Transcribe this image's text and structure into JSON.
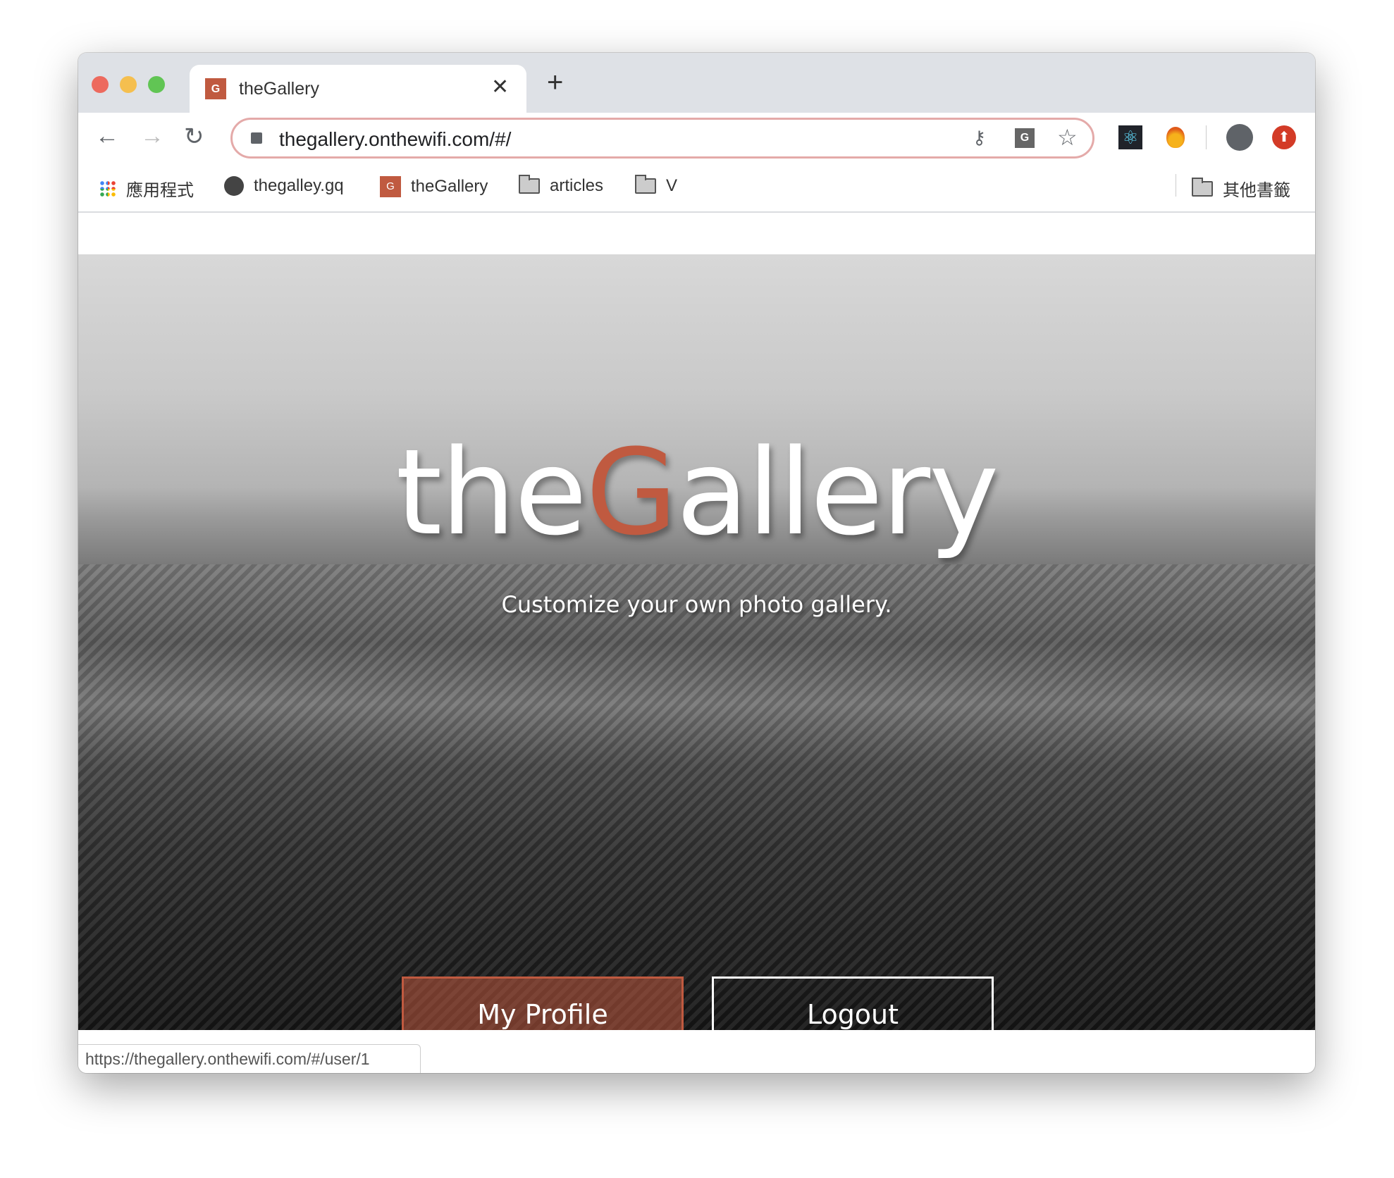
{
  "tab": {
    "title": "theGallery",
    "favicon_letter": "G"
  },
  "toolbar": {
    "url": "thegallery.onthewifi.com/#/"
  },
  "bookmarks": {
    "items": [
      {
        "label": "應用程式",
        "icon": "apps-grid-icon"
      },
      {
        "label": "thegalley.gq",
        "icon": "globe-icon"
      },
      {
        "label": "theGallery",
        "icon": "favicon-g"
      },
      {
        "label": "articles",
        "icon": "folder-icon"
      },
      {
        "label": "V",
        "icon": "folder-icon"
      }
    ],
    "other": "其他書籤"
  },
  "hero": {
    "title_pre": "the",
    "title_accent": "G",
    "title_post": "allery",
    "subtitle": "Customize your own photo gallery.",
    "profile_button": "My Profile",
    "logout_button": "Logout"
  },
  "status_url": "https://thegallery.onthewifi.com/#/user/1",
  "colors": {
    "accent": "#c05a40",
    "omnibox_border": "#e4aaa9"
  }
}
